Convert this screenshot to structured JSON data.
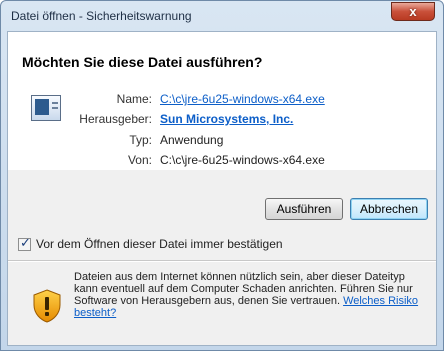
{
  "window": {
    "title": "Datei öffnen - Sicherheitswarnung",
    "close_glyph": "x"
  },
  "question": "Möchten Sie diese Datei ausführen?",
  "details": {
    "name_label": "Name:",
    "name_value": "C:\\c\\jre-6u25-windows-x64.exe",
    "publisher_label": "Herausgeber:",
    "publisher_value": "Sun Microsystems, Inc.",
    "type_label": "Typ:",
    "type_value": "Anwendung",
    "from_label": "Von:",
    "from_value": "C:\\c\\jre-6u25-windows-x64.exe"
  },
  "buttons": {
    "run": "Ausführen",
    "cancel": "Abbrechen"
  },
  "checkbox": {
    "label": "Vor dem Öffnen dieser Datei immer bestätigen",
    "checked": true
  },
  "warning": {
    "text": "Dateien aus dem Internet können nützlich sein, aber dieser Dateityp kann eventuell auf dem Computer Schaden anrichten. Führen Sie nur Software von Herausgebern aus, denen Sie vertrauen.",
    "link": "Welches Risiko besteht?"
  },
  "colors": {
    "link": "#0c5ec8",
    "close": "#c9503a"
  }
}
